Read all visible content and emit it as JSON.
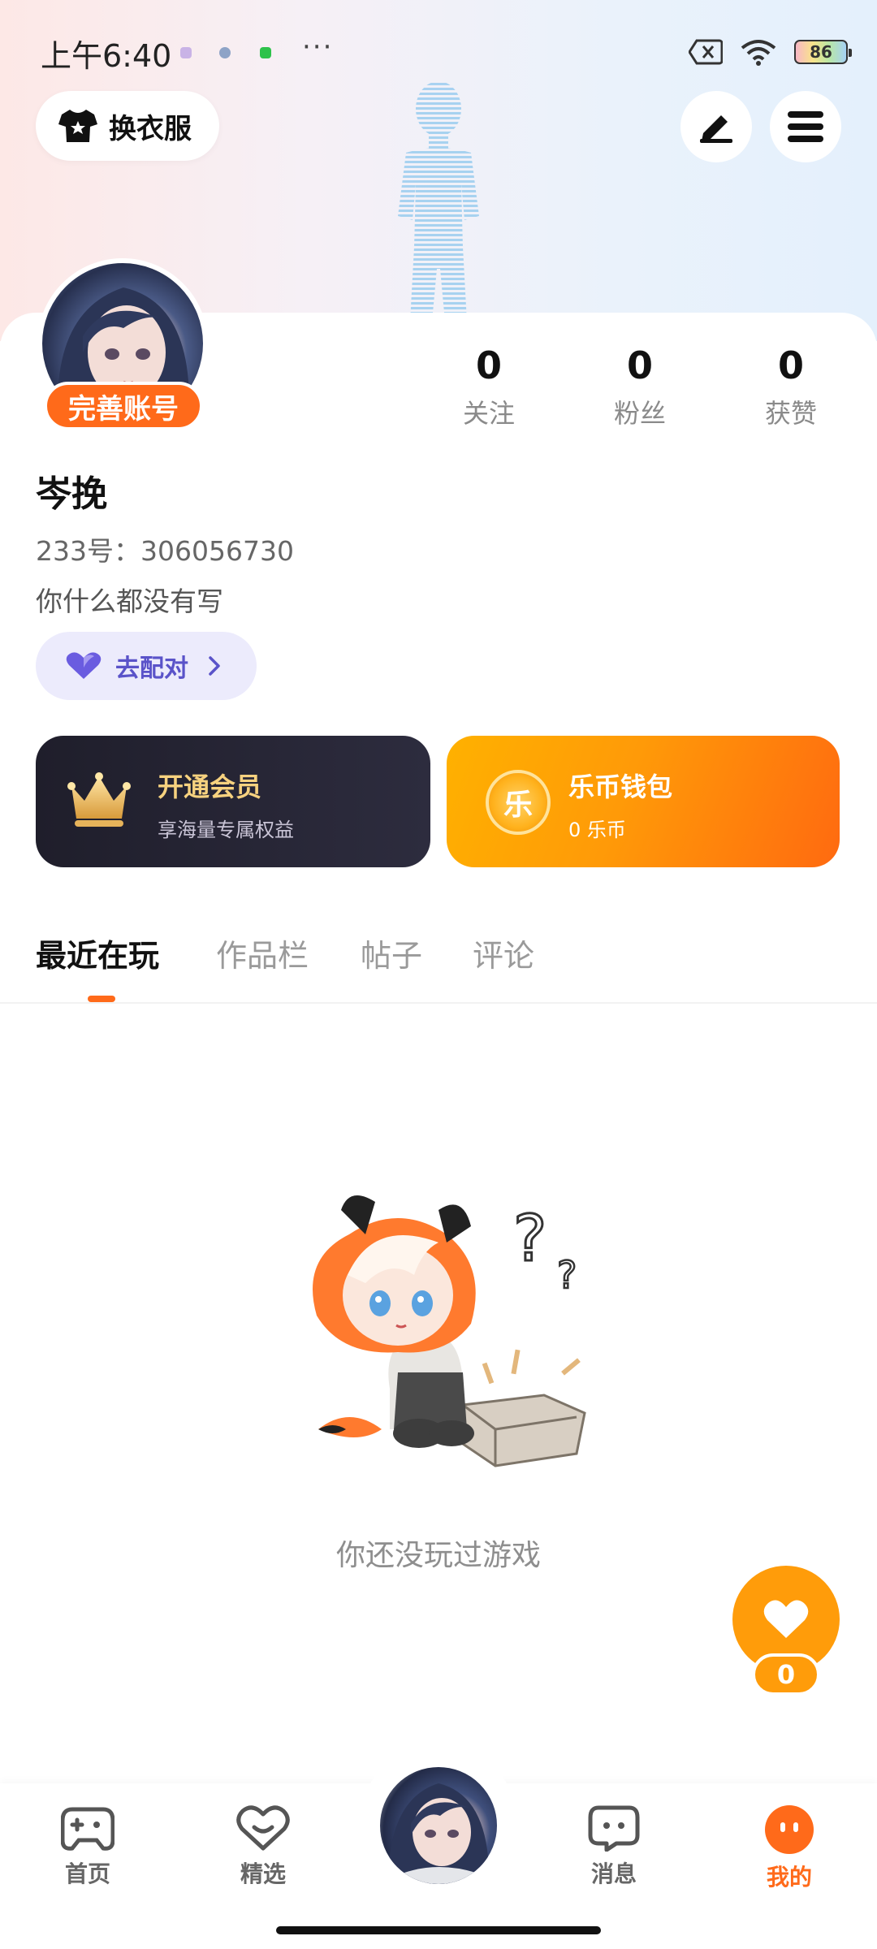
{
  "status_bar": {
    "time": "上午6:40",
    "more": "···",
    "battery": "86"
  },
  "header": {
    "outfit_label": "换衣服"
  },
  "profile": {
    "badge": "完善账号",
    "stats": [
      {
        "num": "0",
        "label": "关注"
      },
      {
        "num": "0",
        "label": "粉丝"
      },
      {
        "num": "0",
        "label": "获赞"
      }
    ],
    "name": "岑挽",
    "id_text": "233号：306056730",
    "bio": "你什么都没有写",
    "match_label": "去配对"
  },
  "cards": {
    "vip_title": "开通会员",
    "vip_sub": "享海量专属权益",
    "wallet_title": "乐币钱包",
    "wallet_sub": "0 乐币",
    "coin_glyph": "乐"
  },
  "tabs": [
    "最近在玩",
    "作品栏",
    "帖子",
    "评论"
  ],
  "empty_text": "你还没玩过游戏",
  "like_count": "0",
  "nav": {
    "home": "首页",
    "featured": "精选",
    "messages": "消息",
    "mine": "我的"
  },
  "colors": {
    "accent": "#ff6a1a",
    "wallet": "#ff9a08",
    "vip_bg": "#1f1e2b",
    "match": "#5a53c9"
  },
  "icons": [
    "shirt-icon",
    "pen-icon",
    "menu-icon",
    "heart-icon",
    "chevron-right-icon",
    "crown-icon",
    "coin-icon",
    "gamepad-icon",
    "heart-outline-icon",
    "chat-icon",
    "face-icon"
  ]
}
